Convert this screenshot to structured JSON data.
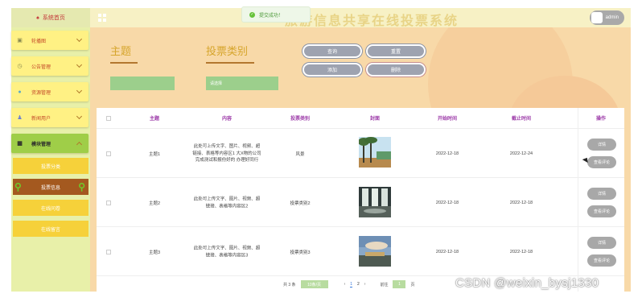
{
  "header": {
    "home_label": "系统首页",
    "system_title": "旅游信息共享在线投票系统",
    "toast_message": "提交成功！",
    "username": "admin"
  },
  "sidebar": {
    "items": [
      {
        "label": "轮播图",
        "icon": "image-icon"
      },
      {
        "label": "公告管理",
        "icon": "clock-icon"
      },
      {
        "label": "资源管理",
        "icon": "pin-icon"
      },
      {
        "label": "新闻用户",
        "icon": "user-icon"
      },
      {
        "label": "模块管理",
        "icon": "grid-icon"
      }
    ],
    "subitems": [
      {
        "label": "投票分类"
      },
      {
        "label": "投票信息"
      },
      {
        "label": "在线问卷"
      },
      {
        "label": "在线留言"
      }
    ]
  },
  "search": {
    "subject_label": "主题",
    "subject_value": "",
    "type_label": "投票类别",
    "type_placeholder": "请选择",
    "query_btn": "查询",
    "reset_btn": "重置",
    "add_btn": "添加",
    "delete_btn": "删除"
  },
  "table": {
    "headers": [
      "主题",
      "内容",
      "投票类别",
      "封面",
      "开始时间",
      "截止时间",
      "操作"
    ],
    "rows": [
      {
        "subject": "主题1",
        "content": "此处可上传文字、图片、视频、超链接、表格等内容区1 大X物的公司 完成测试和报份好的 办理好同行",
        "category": "风景",
        "start": "2022-12-18",
        "end": "2022-12-24"
      },
      {
        "subject": "主题2",
        "content": "此处可上传文字、图片、视频、超链接、表格等内容区2",
        "category": "投票类别2",
        "start": "2022-12-18",
        "end": "2022-12-18"
      },
      {
        "subject": "主题3",
        "content": "此处可上传文字、图片、视频、超链接、表格等内容区3",
        "category": "投票类别3",
        "start": "2022-12-18",
        "end": "2022-12-18"
      }
    ],
    "detail_btn": "详情",
    "review_btn": "查看评论"
  },
  "pagination": {
    "total": "共 3 条",
    "page_size": "10条/页",
    "prev": "‹",
    "page1": "1",
    "page2": "2",
    "next": "›",
    "goto_label": "前往",
    "goto_value": "1",
    "page_suffix": "页"
  },
  "watermark": "CSDN @weixin_bysj1330",
  "colors": {
    "accent": "#9fce48",
    "sidebar_item": "#fff184",
    "submenu": "#f6d13a",
    "title_text": "#9c3aa8"
  }
}
